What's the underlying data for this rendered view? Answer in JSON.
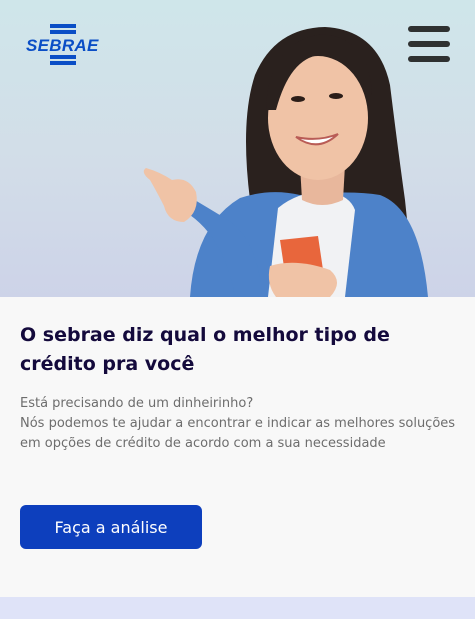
{
  "header": {
    "logo_text": "SEBRAE",
    "menu_icon": "hamburger-menu-icon"
  },
  "hero": {
    "image": "woman-pointing-with-phone"
  },
  "main": {
    "title": "O sebrae diz qual o melhor tipo de crédito pra você",
    "description": [
      "Está precisando de um dinheirinho?",
      "Nós podemos te ajudar a encontrar e indicar as melhores soluções em opções de crédito de acordo com a sua necessidade"
    ],
    "cta_label": "Faça a análise"
  },
  "colors": {
    "brand_blue": "#0a4ec6",
    "button_blue": "#0d3fbd",
    "title_color": "#140a3c",
    "text_gray": "#6d6d6d"
  }
}
